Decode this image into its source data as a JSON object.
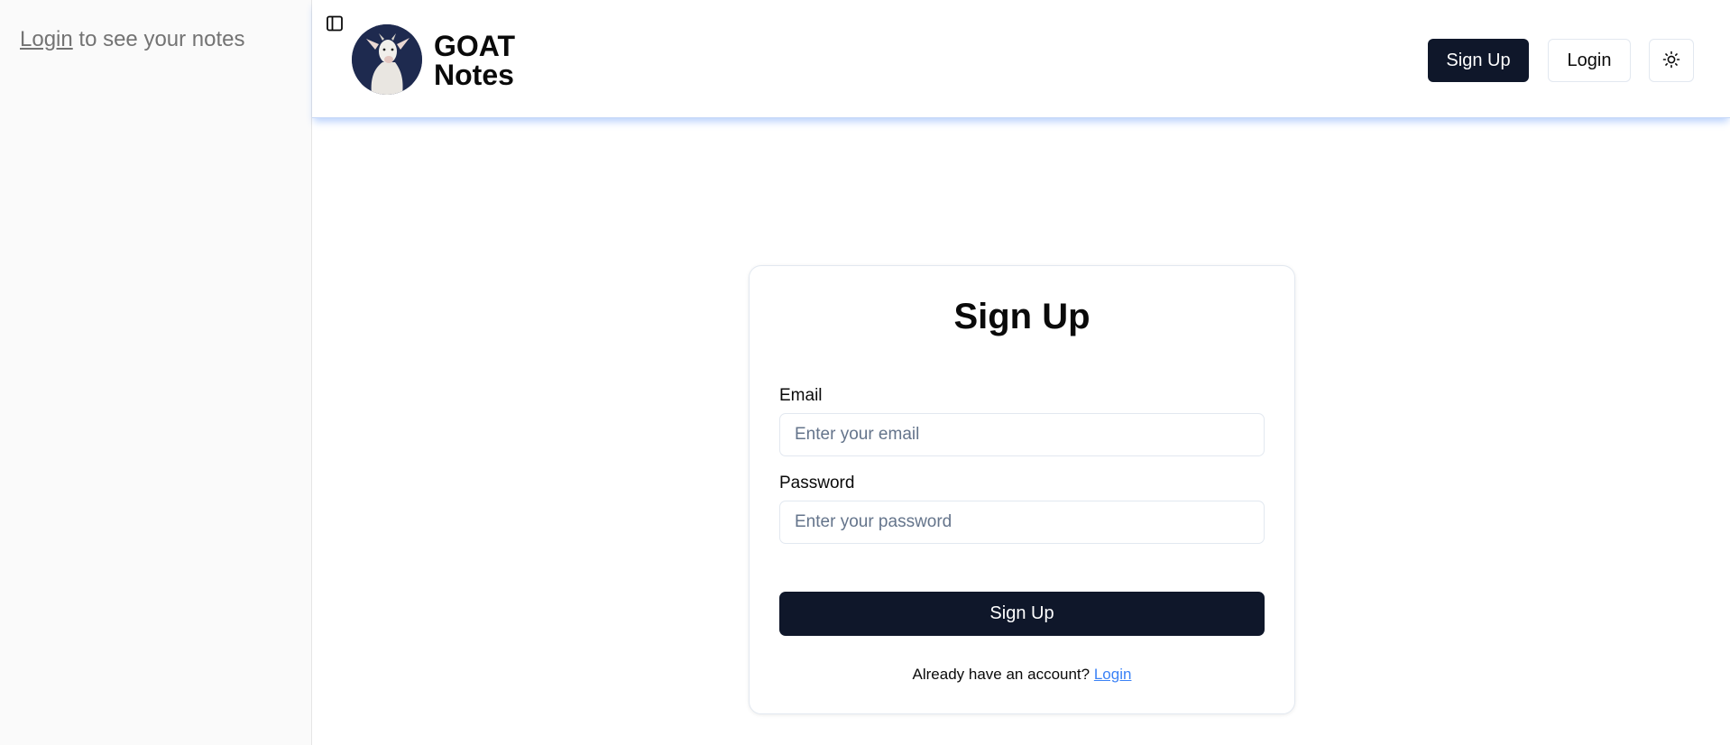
{
  "sidebar": {
    "login_link": "Login",
    "message": " to see your notes"
  },
  "header": {
    "brand_line1": "GOAT",
    "brand_line2": "Notes",
    "signup_label": "Sign Up",
    "login_label": "Login",
    "theme_icon": "sun-icon",
    "toggle_icon": "sidebar-toggle-icon"
  },
  "form": {
    "title": "Sign Up",
    "email_label": "Email",
    "email_placeholder": "Enter your email",
    "email_value": "",
    "password_label": "Password",
    "password_placeholder": "Enter your password",
    "password_value": "",
    "submit_label": "Sign Up",
    "footer_text": "Already have an account? ",
    "footer_link": "Login"
  },
  "colors": {
    "primary": "#0f172a",
    "link": "#3b82f6",
    "sidebar_bg": "#fafafa",
    "muted_text": "#737373"
  }
}
